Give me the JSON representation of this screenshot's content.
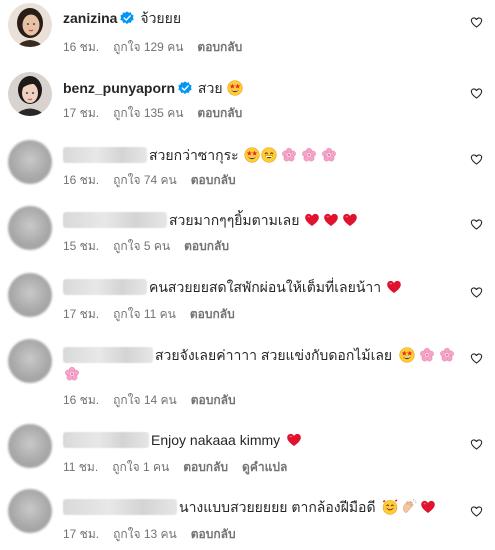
{
  "comments": [
    {
      "username": "zanizina",
      "verified": true,
      "text": "จ้วยยย",
      "emojis": [],
      "time": "16 ชม.",
      "likes": "ถูกใจ 129 คน",
      "reply": "ตอบกลับ",
      "avatar_icon": "profile-photo"
    },
    {
      "username": "benz_punyaporn",
      "verified": true,
      "text": "สวย",
      "emojis": [
        "star-struck-emoji"
      ],
      "time": "17 ชม.",
      "likes": "ถูกใจ 135 คน",
      "reply": "ตอบกลับ",
      "avatar_icon": "profile-photo"
    },
    {
      "username": "",
      "blurred": true,
      "text": "สวยกว่าซากุระ",
      "emojis": [
        "star-struck-emoji",
        "grinning-emoji",
        "cherry-blossom-emoji",
        "cherry-blossom-emoji",
        "cherry-blossom-emoji"
      ],
      "time": "16 ชม.",
      "likes": "ถูกใจ 74 คน",
      "reply": "ตอบกลับ"
    },
    {
      "username": "",
      "blurred": true,
      "text": "สวยมากๆๆยิ้มตามเลย",
      "emojis": [
        "red-heart-emoji",
        "red-heart-emoji",
        "red-heart-emoji"
      ],
      "time": "15 ชม.",
      "likes": "ถูกใจ 5 คน",
      "reply": "ตอบกลับ"
    },
    {
      "username": "",
      "blurred": true,
      "text": "คนสวยยยสดใสพักผ่อนให้เต็มที่เลยน้าา",
      "emojis": [
        "red-heart-emoji"
      ],
      "time": "17 ชม.",
      "likes": "ถูกใจ 11 คน",
      "reply": "ตอบกลับ"
    },
    {
      "username": "",
      "blurred": true,
      "text": "สวยจังเลยค่าาาา สวยแข่งกับดอกไม้เลย",
      "emojis": [
        "star-struck-emoji",
        "cherry-blossom-emoji",
        "cherry-blossom-emoji",
        "cherry-blossom-emoji"
      ],
      "time": "16 ชม.",
      "likes": "ถูกใจ 14 คน",
      "reply": "ตอบกลับ"
    },
    {
      "username": "",
      "blurred": true,
      "text": "Enjoy nakaaa kimmy",
      "emojis": [
        "red-heart-emoji"
      ],
      "time": "11 ชม.",
      "likes": "ถูกใจ 1 คน",
      "reply": "ตอบกลับ",
      "translate": "ดูคำแปล"
    },
    {
      "username": "",
      "blurred": true,
      "text": "นางแบบสวยยยยย ตากล้องฝีมือดี",
      "emojis": [
        "smiling-hearts-emoji",
        "clapping-hands-emoji",
        "red-heart-emoji"
      ],
      "time": "17 ชม.",
      "likes": "ถูกใจ 13 คน",
      "reply": "ตอบกลับ"
    }
  ],
  "colors": {
    "verified": "#0095f6",
    "meta": "#737373",
    "heart": "#e0122f"
  }
}
